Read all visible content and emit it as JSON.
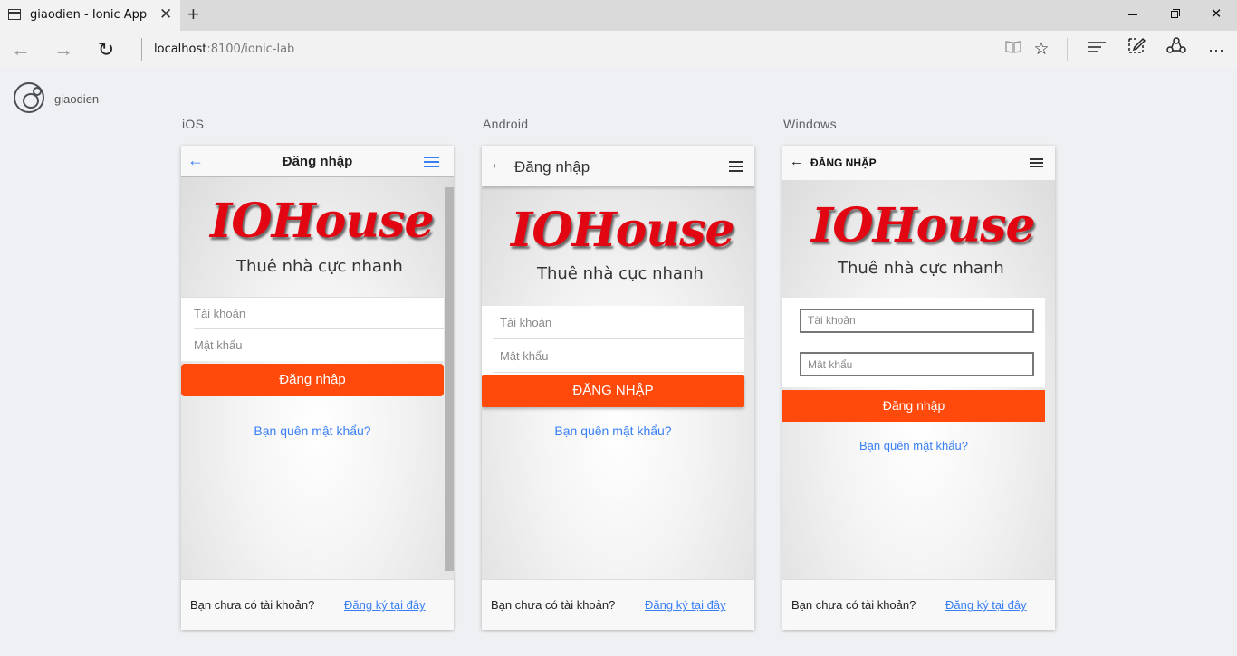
{
  "browser": {
    "tab_title": "giaodien - Ionic App",
    "address_host": "localhost",
    "address_path": ":8100/ionic-lab"
  },
  "lab": {
    "app_name": "giaodien",
    "platforms": [
      "iOS",
      "Android",
      "Windows"
    ]
  },
  "app": {
    "brand": "IOHouse",
    "slogan": "Thuê nhà cực nhanh",
    "username_placeholder": "Tài khoản",
    "password_placeholder": "Mật khẩu",
    "forgot_link": "Bạn quên mật khẩu?",
    "no_account_text": "Bạn chưa có tài khoản?",
    "register_link": "Đăng ký tại đây",
    "ios": {
      "header_title": "Đăng nhập",
      "login_button": "Đăng nhập"
    },
    "android": {
      "header_title": "Đăng nhập",
      "login_button": "ĐĂNG NHẬP"
    },
    "windows": {
      "header_title": "ĐĂNG NHẬP",
      "login_button": "Đăng nhập"
    }
  },
  "colors": {
    "primary_button": "#ff4a0c",
    "link": "#387ef5",
    "brand_red": "#e20612"
  }
}
